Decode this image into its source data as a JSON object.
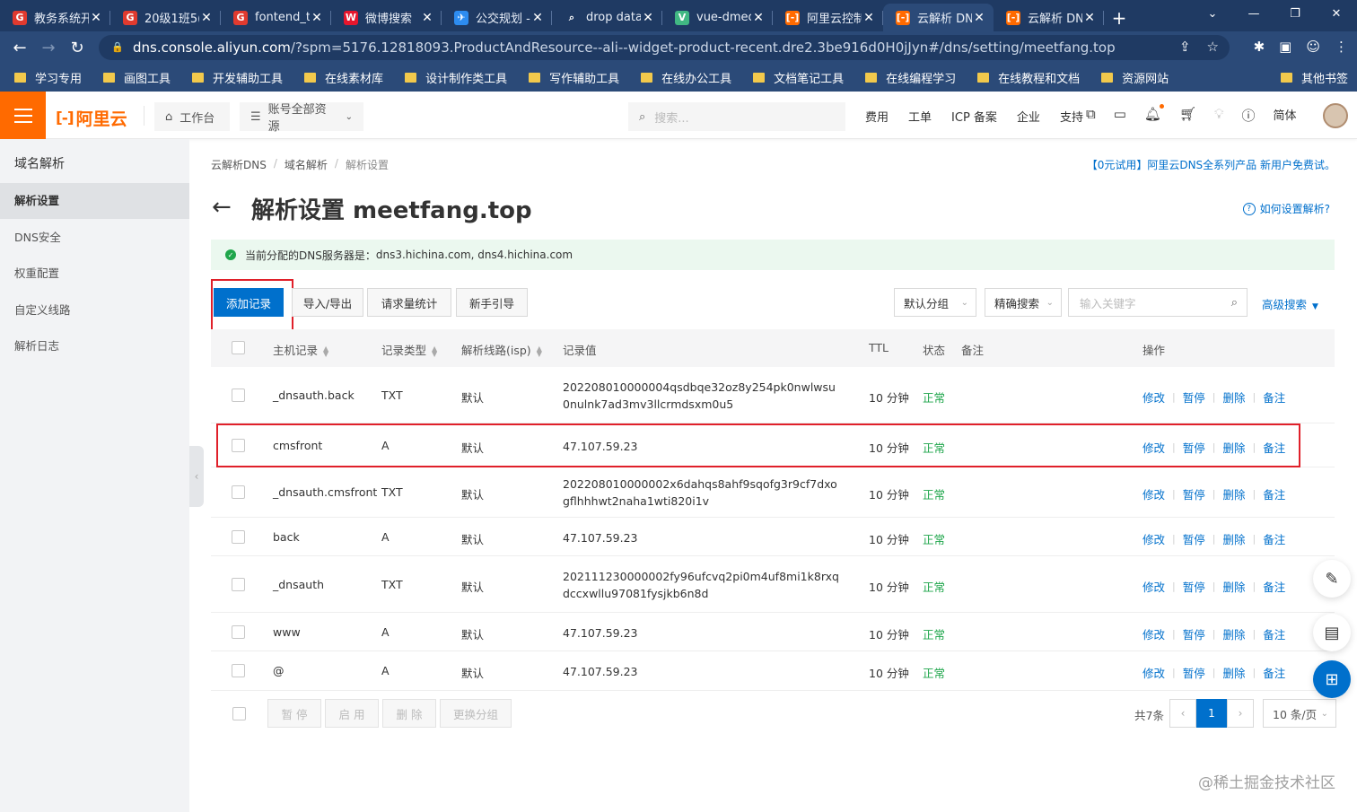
{
  "browser": {
    "tabs": [
      {
        "title": "教务系统开",
        "icon": "G",
        "color": "#e03a2f"
      },
      {
        "title": "20级1班5(",
        "icon": "G",
        "color": "#e03a2f"
      },
      {
        "title": "fontend_t",
        "icon": "G",
        "color": "#e03a2f"
      },
      {
        "title": "微博搜索",
        "icon": "W",
        "color": "#e6162d"
      },
      {
        "title": "公交规划 -",
        "icon": "✈",
        "color": "#2d8cf0"
      },
      {
        "title": "drop data",
        "icon": "⌕",
        "color": "#1f3a63"
      },
      {
        "title": "vue-dmeo",
        "icon": "V",
        "color": "#41b883"
      },
      {
        "title": "阿里云控制",
        "icon": "[-]",
        "color": "#ff6a00"
      },
      {
        "title": "云解析 DN",
        "icon": "[-]",
        "color": "#ff6a00"
      },
      {
        "title": "云解析 DN",
        "icon": "[-]",
        "color": "#ff6a00"
      }
    ],
    "url_domain": "dns.console.aliyun.com",
    "url_path": "/?spm=5176.12818093.ProductAndResource--ali--widget-product-recent.dre2.3be916d0H0jJyn#/dns/setting/meetfang.top",
    "bookmarks": [
      "学习专用",
      "画图工具",
      "开发辅助工具",
      "在线素材库",
      "设计制作类工具",
      "写作辅助工具",
      "在线办公工具",
      "文档笔记工具",
      "在线编程学习",
      "在线教程和文档",
      "资源网站"
    ],
    "bookmarks_other": "其他书签"
  },
  "topnav": {
    "logo_text": "阿里云",
    "workbench": "工作台",
    "resources": "账号全部资源",
    "search_placeholder": "搜索...",
    "links": [
      "费用",
      "工单",
      "ICP 备案",
      "企业",
      "支持"
    ],
    "lang": "简体"
  },
  "sidebar": {
    "title": "域名解析",
    "items": [
      "解析设置",
      "DNS安全",
      "权重配置",
      "自定义线路",
      "解析日志"
    ],
    "active_index": 0
  },
  "breadcrumb": [
    "云解析DNS",
    "域名解析",
    "解析设置"
  ],
  "promo": "【0元试用】阿里云DNS全系列产品 新用户免费试。",
  "page_title": "解析设置 meetfang.top",
  "howto": "如何设置解析?",
  "notice": {
    "label": "当前分配的DNS服务器是：",
    "servers": "dns3.hichina.com, dns4.hichina.com"
  },
  "toolbar": {
    "add": "添加记录",
    "import_export": "导入/导出",
    "stats": "请求量统计",
    "guide": "新手引导",
    "group": "默认分组",
    "search_mode": "精确搜索",
    "keyword_placeholder": "输入关键字",
    "advanced": "高级搜索"
  },
  "table": {
    "headers": {
      "host": "主机记录",
      "type": "记录类型",
      "line": "解析线路(isp)",
      "value": "记录值",
      "ttl": "TTL",
      "status": "状态",
      "remark": "备注",
      "ops": "操作"
    },
    "rows": [
      {
        "host": "_dnsauth.back",
        "type": "TXT",
        "line": "默认",
        "value": "202208010000004qsdbqe32oz8y254pk0nwlwsu0nulnk7ad3mv3llcrmdsxm0u5",
        "ttl": "10 分钟",
        "status": "正常"
      },
      {
        "host": "cmsfront",
        "type": "A",
        "line": "默认",
        "value": "47.107.59.23",
        "ttl": "10 分钟",
        "status": "正常"
      },
      {
        "host": "_dnsauth.cmsfront",
        "type": "TXT",
        "line": "默认",
        "value": "202208010000002x6dahqs8ahf9sqofg3r9cf7dxogflhhhwt2naha1wti820i1v",
        "ttl": "10 分钟",
        "status": "正常"
      },
      {
        "host": "back",
        "type": "A",
        "line": "默认",
        "value": "47.107.59.23",
        "ttl": "10 分钟",
        "status": "正常"
      },
      {
        "host": "_dnsauth",
        "type": "TXT",
        "line": "默认",
        "value": "202111230000002fy96ufcvq2pi0m4uf8mi1k8rxqdccxwllu97081fysjkb6n8d",
        "ttl": "10 分钟",
        "status": "正常"
      },
      {
        "host": "www",
        "type": "A",
        "line": "默认",
        "value": "47.107.59.23",
        "ttl": "10 分钟",
        "status": "正常"
      },
      {
        "host": "@",
        "type": "A",
        "line": "默认",
        "value": "47.107.59.23",
        "ttl": "10 分钟",
        "status": "正常"
      }
    ],
    "ops": [
      "修改",
      "暂停",
      "删除",
      "备注"
    ]
  },
  "footer": {
    "pause": "暂 停",
    "enable": "启 用",
    "delete": "删 除",
    "change_group": "更换分组",
    "total": "共7条",
    "page": "1",
    "page_size": "10 条/页"
  },
  "watermark": "@稀土掘金技术社区",
  "colors": {
    "brand": "#ff6a00",
    "primary": "#0070cc",
    "ok": "#1fa64b",
    "highlight": "#e0202a"
  }
}
